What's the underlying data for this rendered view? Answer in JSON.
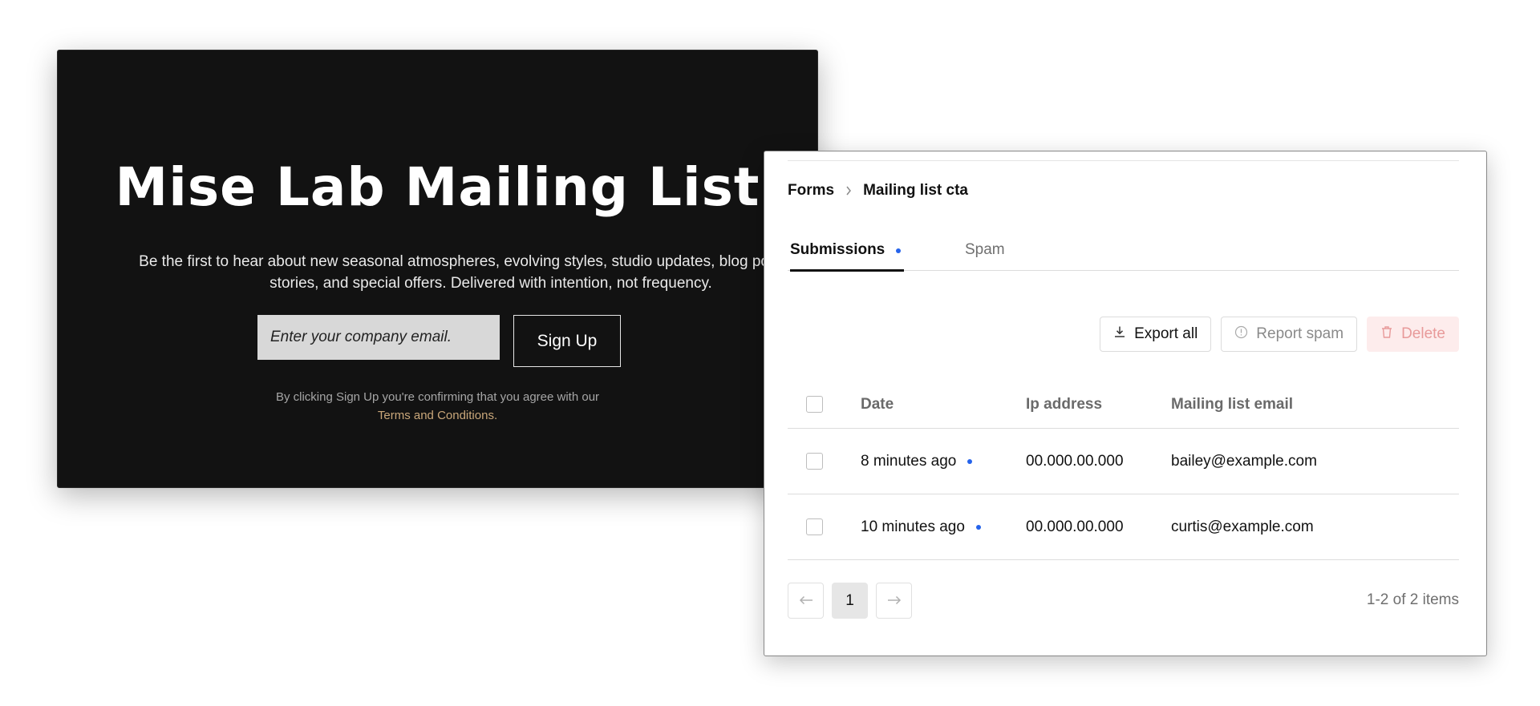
{
  "signup": {
    "title": "Mise Lab Mailing List",
    "description": "Be the first to hear about new seasonal atmospheres, evolving styles, studio updates, blog posts, project\nstories, and special offers. Delivered with intention, not frequency.",
    "email_placeholder": "Enter your company email.",
    "button_label": "Sign Up",
    "legal_text": "By clicking Sign Up you're confirming that you agree with our",
    "terms_link": "Terms and Conditions.",
    "colors": {
      "background": "#121212",
      "link": "#c9a77a"
    }
  },
  "admin": {
    "breadcrumb": {
      "parent": "Forms",
      "current": "Mailing list cta"
    },
    "tabs": [
      {
        "label": "Submissions",
        "active": true,
        "has_indicator": true
      },
      {
        "label": "Spam",
        "active": false,
        "has_indicator": false
      }
    ],
    "toolbar": {
      "export_label": "Export all",
      "report_spam_label": "Report spam",
      "delete_label": "Delete",
      "icons": {
        "export": "download-icon",
        "report": "alert-circle-icon",
        "delete": "trash-icon"
      }
    },
    "table": {
      "columns": [
        "Date",
        "Ip address",
        "Mailing list email"
      ],
      "rows": [
        {
          "date": "8 minutes ago",
          "ip": "00.000.00.000",
          "email": "bailey@example.com",
          "unread": true
        },
        {
          "date": "10 minutes ago",
          "ip": "00.000.00.000",
          "email": "curtis@example.com",
          "unread": true
        }
      ]
    },
    "pagination": {
      "current_page": "1",
      "summary": "1-2 of 2 items"
    },
    "colors": {
      "accent": "#2563eb",
      "danger_bg": "#fdecec",
      "danger_text": "#e89a9a"
    }
  }
}
